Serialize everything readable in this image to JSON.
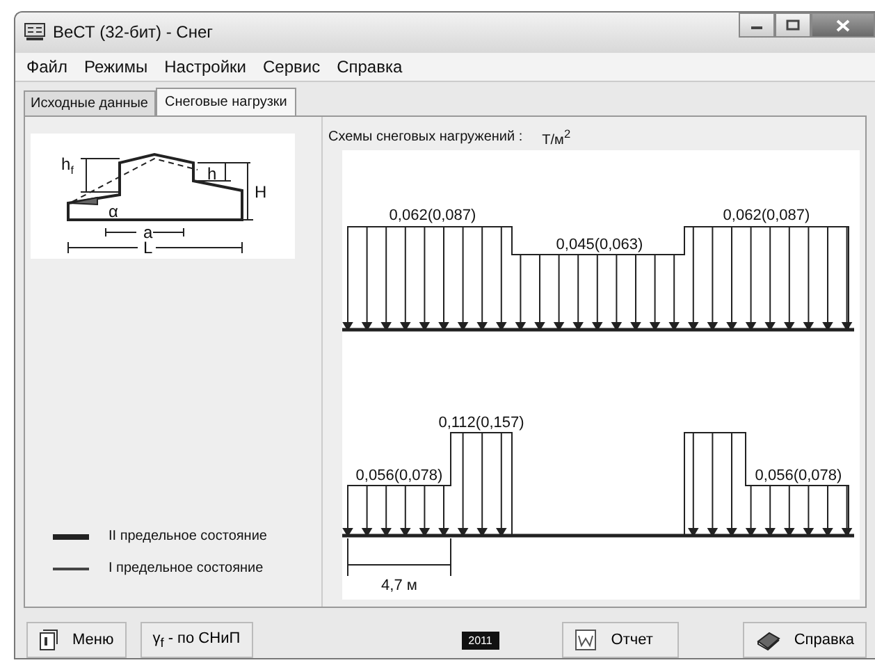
{
  "window": {
    "title": "ВеСТ (32-бит) - Снег"
  },
  "menu": [
    "Файл",
    "Режимы",
    "Настройки",
    "Сервис",
    "Справка"
  ],
  "tabs": [
    {
      "label": "Исходные данные",
      "selected": false
    },
    {
      "label": "Снеговые нагрузки",
      "selected": true
    }
  ],
  "sketch": {
    "labels": [
      {
        "text": "h",
        "sub": "f"
      },
      {
        "text": "h"
      },
      {
        "text": "H"
      },
      {
        "text": "α"
      },
      {
        "text": "a"
      },
      {
        "text": "L"
      }
    ]
  },
  "legend": [
    {
      "kind": "thick",
      "label": "II предельное состояние"
    },
    {
      "kind": "thin",
      "label": "I предельное состояние"
    }
  ],
  "schemes_title": "Схемы снеговых нагружений :",
  "units": "Т/м$^{2}$",
  "scheme_1": {
    "labels": [
      "0,062(0,087)",
      "0,045(0,063)",
      "0,062(0,087)"
    ]
  },
  "scheme_2": {
    "labels": [
      "0,112(0,157)",
      "0,056(0,078)",
      "0,056(0,078)"
    ],
    "dimension": "4,7 м"
  },
  "buttons": [
    {
      "kind": "menu",
      "label": "Меню"
    },
    {
      "kind": "snip",
      "label": "γ$_{f}$ - по СНиП"
    },
    {
      "kind": "badge",
      "label": "2011"
    },
    {
      "kind": "report",
      "label": "Отчет"
    },
    {
      "kind": "help",
      "label": "Справка"
    }
  ]
}
